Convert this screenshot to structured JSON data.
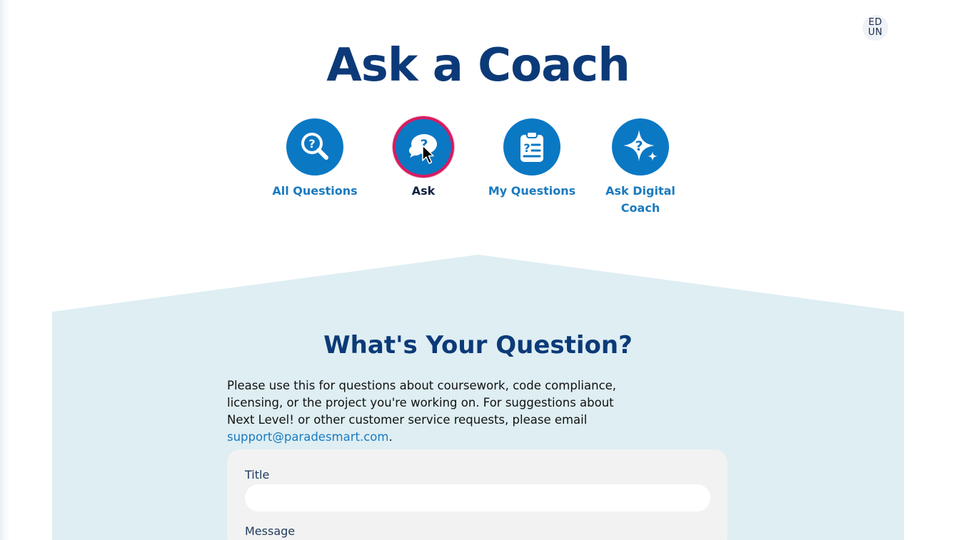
{
  "user": {
    "initials_line1": "ED",
    "initials_line2": "UN"
  },
  "page_title": "Ask a Coach",
  "nav": {
    "items": [
      {
        "label": "All Questions",
        "icon": "search-question-icon",
        "active": false
      },
      {
        "label": "Ask",
        "icon": "chat-question-icon",
        "active": true
      },
      {
        "label": "My Questions",
        "icon": "clipboard-question-icon",
        "active": false
      },
      {
        "label": "Ask Digital Coach",
        "icon": "sparkle-question-icon",
        "active": false
      }
    ]
  },
  "form_section": {
    "title": "What's Your Question?",
    "intro_text": "Please use this for questions about coursework, code compliance, licensing, or the project you're working on. For suggestions about Next Level! or other customer service requests, please email",
    "support_email": "support@paradesmart.com",
    "intro_end": ".",
    "title_label": "Title",
    "title_value": "",
    "message_label": "Message"
  },
  "colors": {
    "brand_navy": "#0c3a78",
    "brand_blue": "#0b78c4",
    "active_ring": "#d81b60",
    "panel_bg": "#deeef3",
    "card_bg": "#f2f2f2"
  }
}
